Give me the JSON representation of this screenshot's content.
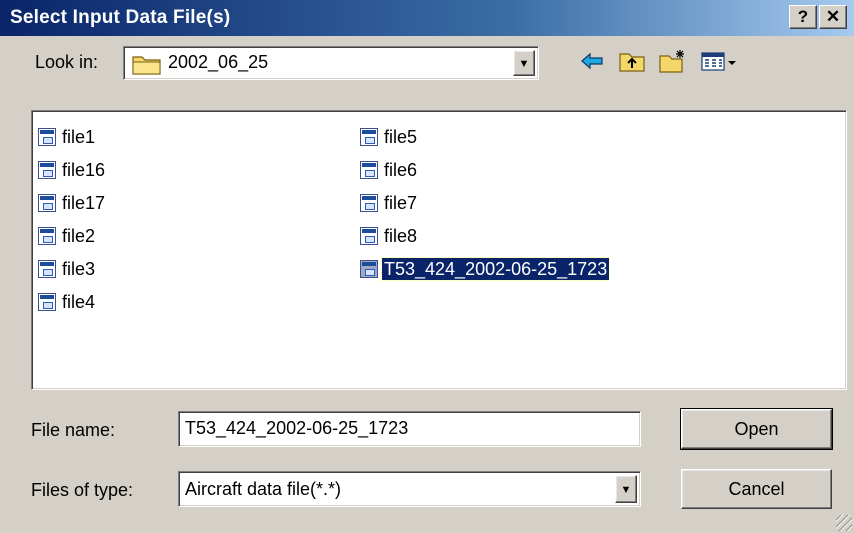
{
  "window": {
    "title": "Select Input Data File(s)",
    "help_label": "?",
    "close_label": "✕"
  },
  "look_in": {
    "label": "Look in:",
    "value": "2002_06_25"
  },
  "toolbar": {
    "back_icon": "back-arrow-icon",
    "up_icon": "up-one-level-icon",
    "new_folder_icon": "new-folder-icon",
    "view_menu_icon": "view-menu-icon"
  },
  "files": {
    "col1": [
      "file1",
      "file16",
      "file17",
      "file2",
      "file3",
      "file4"
    ],
    "col2": [
      "file5",
      "file6",
      "file7",
      "file8",
      "T53_424_2002-06-25_1723"
    ],
    "selected": "T53_424_2002-06-25_1723"
  },
  "file_name": {
    "label": "File name:",
    "value": "T53_424_2002-06-25_1723"
  },
  "file_type": {
    "label": "Files of type:",
    "value": "Aircraft data file(*.*)"
  },
  "buttons": {
    "open": "Open",
    "cancel": "Cancel"
  },
  "colors": {
    "title_start": "#0a246a",
    "title_end": "#a6caf0",
    "selection": "#0a246a",
    "face": "#d4d0c8"
  }
}
